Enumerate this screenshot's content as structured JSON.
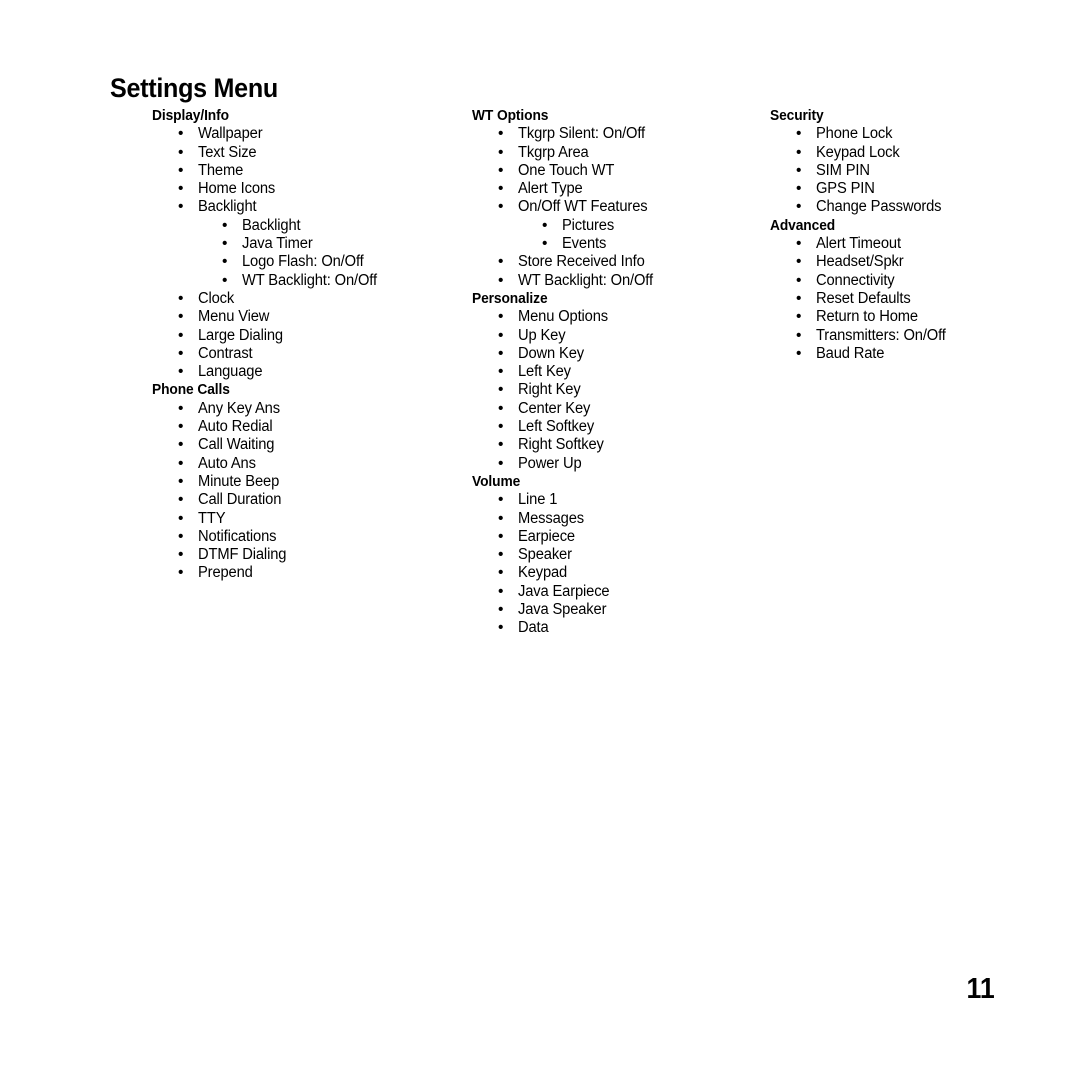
{
  "document": {
    "title": "Settings Menu",
    "page_number": "11"
  },
  "columns": [
    {
      "sections": [
        {
          "heading": "Display/Info",
          "items": [
            {
              "label": "Wallpaper",
              "level": 1
            },
            {
              "label": "Text Size",
              "level": 1
            },
            {
              "label": "Theme",
              "level": 1
            },
            {
              "label": "Home Icons",
              "level": 1
            },
            {
              "label": "Backlight",
              "level": 1
            },
            {
              "label": "Backlight",
              "level": 2
            },
            {
              "label": "Java Timer",
              "level": 2
            },
            {
              "label": "Logo Flash: On/Off",
              "level": 2
            },
            {
              "label": "WT Backlight: On/Off",
              "level": 2
            },
            {
              "label": "Clock",
              "level": 1
            },
            {
              "label": "Menu View",
              "level": 1
            },
            {
              "label": "Large Dialing",
              "level": 1
            },
            {
              "label": "Contrast",
              "level": 1
            },
            {
              "label": "Language",
              "level": 1
            }
          ]
        },
        {
          "heading": "Phone Calls",
          "items": [
            {
              "label": "Any Key Ans",
              "level": 1
            },
            {
              "label": "Auto Redial",
              "level": 1
            },
            {
              "label": "Call Waiting",
              "level": 1
            },
            {
              "label": "Auto Ans",
              "level": 1
            },
            {
              "label": "Minute Beep",
              "level": 1
            },
            {
              "label": "Call Duration",
              "level": 1
            },
            {
              "label": "TTY",
              "level": 1
            },
            {
              "label": "Notifications",
              "level": 1
            },
            {
              "label": "DTMF Dialing",
              "level": 1
            },
            {
              "label": "Prepend",
              "level": 1
            }
          ]
        }
      ]
    },
    {
      "sections": [
        {
          "heading": "WT Options",
          "items": [
            {
              "label": "Tkgrp Silent: On/Off",
              "level": 1
            },
            {
              "label": "Tkgrp Area",
              "level": 1
            },
            {
              "label": "One Touch WT",
              "level": 1
            },
            {
              "label": "Alert Type",
              "level": 1
            },
            {
              "label": "On/Off WT Features",
              "level": 1
            },
            {
              "label": "Pictures",
              "level": 2
            },
            {
              "label": "Events",
              "level": 2
            },
            {
              "label": "Store Received Info",
              "level": 1
            },
            {
              "label": "WT Backlight: On/Off",
              "level": 1
            }
          ]
        },
        {
          "heading": "Personalize",
          "items": [
            {
              "label": "Menu Options",
              "level": 1
            },
            {
              "label": "Up Key",
              "level": 1
            },
            {
              "label": "Down Key",
              "level": 1
            },
            {
              "label": "Left Key",
              "level": 1
            },
            {
              "label": "Right Key",
              "level": 1
            },
            {
              "label": "Center Key",
              "level": 1
            },
            {
              "label": "Left Softkey",
              "level": 1
            },
            {
              "label": "Right Softkey",
              "level": 1
            },
            {
              "label": "Power Up",
              "level": 1
            }
          ]
        },
        {
          "heading": "Volume",
          "items": [
            {
              "label": "Line 1",
              "level": 1
            },
            {
              "label": "Messages",
              "level": 1
            },
            {
              "label": "Earpiece",
              "level": 1
            },
            {
              "label": "Speaker",
              "level": 1
            },
            {
              "label": "Keypad",
              "level": 1
            },
            {
              "label": "Java Earpiece",
              "level": 1
            },
            {
              "label": "Java Speaker",
              "level": 1
            },
            {
              "label": "Data",
              "level": 1
            }
          ]
        }
      ]
    },
    {
      "sections": [
        {
          "heading": "Security",
          "items": [
            {
              "label": "Phone Lock",
              "level": 1
            },
            {
              "label": "Keypad Lock",
              "level": 1
            },
            {
              "label": "SIM PIN",
              "level": 1
            },
            {
              "label": "GPS PIN",
              "level": 1
            },
            {
              "label": "Change Passwords",
              "level": 1
            }
          ]
        },
        {
          "heading": "Advanced",
          "items": [
            {
              "label": "Alert Timeout",
              "level": 1
            },
            {
              "label": "Headset/Spkr",
              "level": 1
            },
            {
              "label": "Connectivity",
              "level": 1
            },
            {
              "label": "Reset Defaults",
              "level": 1
            },
            {
              "label": "Return to Home",
              "level": 1
            },
            {
              "label": "Transmitters: On/Off",
              "level": 1
            },
            {
              "label": "Baud Rate",
              "level": 1
            }
          ]
        }
      ]
    }
  ],
  "glyphs": {
    "bullet": "•"
  }
}
